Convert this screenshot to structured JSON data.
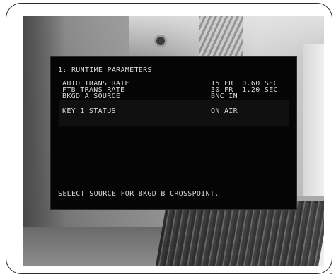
{
  "menu": {
    "title": "1: RUNTIME PARAMETERS",
    "parameters": [
      {
        "name": "AUTO TRANS RATE",
        "value": "15 FR  0.60 SEC"
      },
      {
        "name": "FTB TRANS RATE",
        "value": "30 FR  1.20 SEC"
      },
      {
        "name": "BKGD A SOURCE",
        "value": "BNC IN"
      },
      {
        "name": "KEY 1 STATUS",
        "value": "ON AIR"
      }
    ],
    "prompt": "SELECT SOURCE FOR BKGD B CROSSPOINT."
  }
}
